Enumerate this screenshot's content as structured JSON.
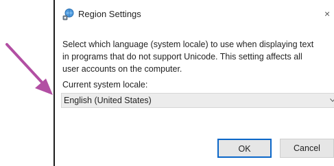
{
  "window": {
    "title": "Region Settings",
    "icon": "globe-settings-icon",
    "close_glyph": "×"
  },
  "description": "Select which language (system locale) to use when displaying text in programs that do not support Unicode. This setting affects all user accounts on the computer.",
  "locale": {
    "label": "Current system locale:",
    "selected": "English (United States)"
  },
  "buttons": {
    "ok": "OK",
    "cancel": "Cancel"
  },
  "colors": {
    "annotation_arrow": "#b24fa3",
    "ok_border": "#0a66c8",
    "select_background": "#ececec"
  }
}
